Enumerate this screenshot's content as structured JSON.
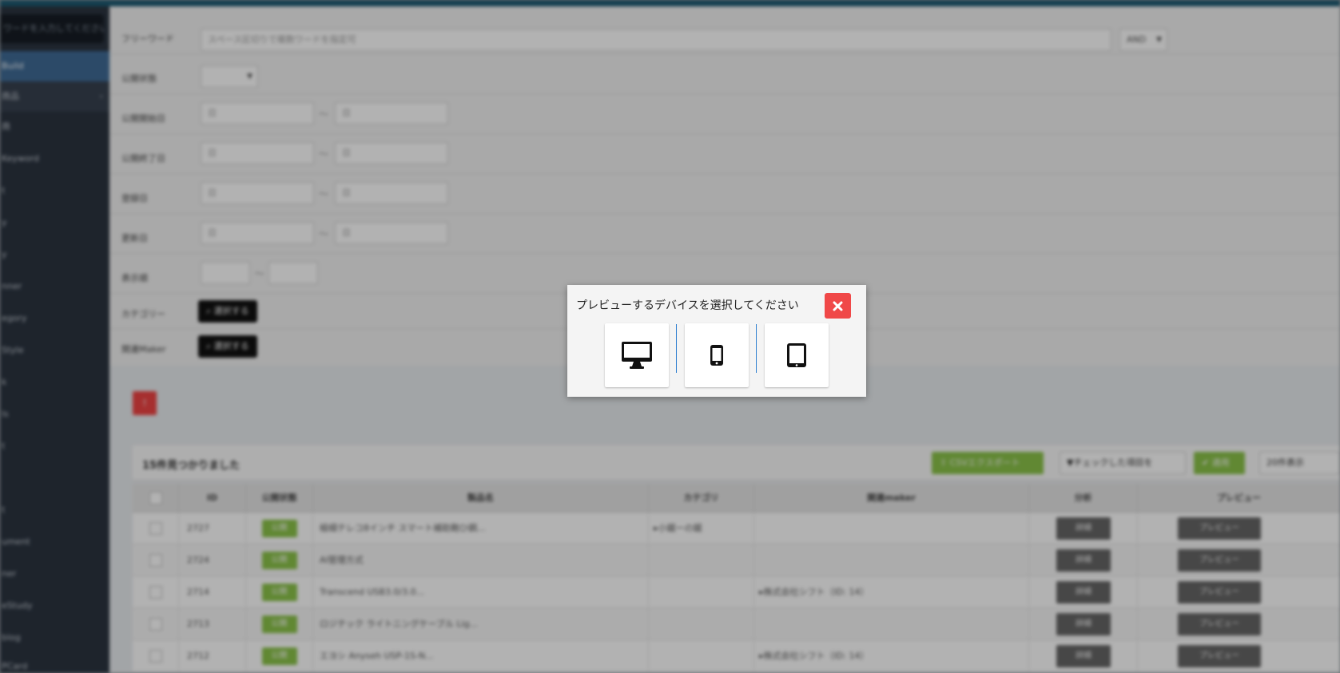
{
  "sidebar": {
    "search_placeholder": "ワードを入力してください",
    "items": [
      {
        "label": "Build"
      },
      {
        "label": "商品"
      },
      {
        "label": "商"
      },
      {
        "label": "Keyword"
      },
      {
        "label": "t"
      },
      {
        "label": "y"
      },
      {
        "label": "y"
      },
      {
        "label": "nner"
      },
      {
        "label": "egory"
      },
      {
        "label": "Style"
      },
      {
        "label": "k"
      },
      {
        "label": "ls"
      },
      {
        "label": "t"
      },
      {
        "label": ""
      },
      {
        "label": "t"
      },
      {
        "label": "ument"
      },
      {
        "label": "ner"
      },
      {
        "label": "eStudy"
      },
      {
        "label": "blog"
      },
      {
        "label": "PCard"
      }
    ]
  },
  "filters": {
    "freeword": {
      "label": "フリーワード",
      "placeholder": "スペース区切りで複数ワードを指定可",
      "mode": "AND"
    },
    "status": {
      "label": "公開状態",
      "value": ""
    },
    "publish_start": {
      "label": "公開開始日",
      "from": "日",
      "to": "日"
    },
    "publish_end": {
      "label": "公開終了日",
      "from": "日",
      "to": "日"
    },
    "registered": {
      "label": "登録日",
      "from": "日",
      "to": "日"
    },
    "updated": {
      "label": "更新日",
      "from": "日",
      "to": "日"
    },
    "sort_order": {
      "label": "表示順",
      "from": "",
      "to": ""
    },
    "category": {
      "label": "カテゴリー",
      "button": "選択する"
    },
    "maker": {
      "label": "関連Maker",
      "button": "選択する"
    }
  },
  "results": {
    "count_text": "15件見つかりました",
    "csv_button": "CSVエクスポート",
    "bulk_select": "▼チェックした項目を",
    "apply_button": "適用",
    "per_page": "20件表示"
  },
  "table": {
    "headers": [
      "",
      "ID",
      "公開状態",
      "製品名",
      "カテゴリ",
      "関連maker",
      "分析",
      "プレビュー"
    ],
    "rows": [
      {
        "id": "2727",
        "status": "公開",
        "name": "極細テレコ8インチ スマート補助鞄ひ鋼...",
        "category": "▸小鋸ーの鋸",
        "maker": "",
        "action": "詳細",
        "preview": "プレビュー"
      },
      {
        "id": "2724",
        "status": "公開",
        "name": "AI管理方式",
        "category": "",
        "maker": "",
        "action": "詳細",
        "preview": "プレビュー"
      },
      {
        "id": "2714",
        "status": "公開",
        "name": "Transcend USB3.0/3.0...",
        "category": "",
        "maker": "▸株式会社シフト（ID: 14）",
        "action": "詳細",
        "preview": "プレビュー"
      },
      {
        "id": "2713",
        "status": "公開",
        "name": "ロジテック ライトニングケーブル Lig...",
        "category": "",
        "maker": "",
        "action": "詳細",
        "preview": "プレビュー"
      },
      {
        "id": "2712",
        "status": "公開",
        "name": "エヨシ Anyseh USP-1S-N...",
        "category": "",
        "maker": "▸株式会社シフト（ID: 14）",
        "action": "詳細",
        "preview": "プレビュー"
      }
    ]
  },
  "modal": {
    "title": "プレビューするデバイスを選択してください",
    "devices": [
      {
        "icon": "desktop-icon"
      },
      {
        "icon": "smartphone-icon"
      },
      {
        "icon": "tablet-icon"
      }
    ],
    "close_color": "#f04848"
  }
}
